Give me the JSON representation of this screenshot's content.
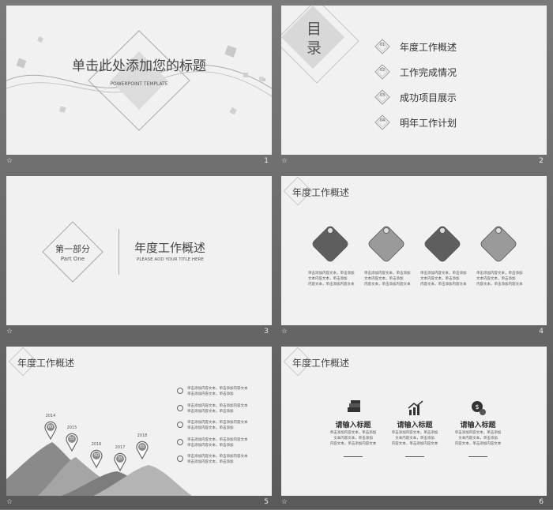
{
  "slide1": {
    "title": "单击此处添加您的标题",
    "subtitle": "POWERPOINT TEMPLATE",
    "number": "1"
  },
  "slide2": {
    "title_char1": "目",
    "title_char2": "录",
    "items": [
      {
        "num": "01",
        "label": "年度工作概述"
      },
      {
        "num": "02",
        "label": "工作完成情况"
      },
      {
        "num": "03",
        "label": "成功项目展示"
      },
      {
        "num": "04",
        "label": "明年工作计划"
      }
    ],
    "number": "2"
  },
  "slide3": {
    "part_label": "第一部分",
    "part_en": "Part One",
    "title": "年度工作概述",
    "subtitle": "PLEASE ADD YOUR TITLE HERE",
    "number": "3"
  },
  "slide4": {
    "title": "年度工作概述",
    "text_line1": "单击添加内容文本，单击添加",
    "text_line2": "文本内容文本，单击添加",
    "text_line3": "内容文本，单击添加内容文本",
    "number": "4"
  },
  "slide5": {
    "title": "年度工作概述",
    "years": [
      {
        "year": "2014",
        "value": "80"
      },
      {
        "year": "2015",
        "value": "55"
      },
      {
        "year": "2016",
        "value": "50"
      },
      {
        "year": "2017",
        "value": "35"
      },
      {
        "year": "2018",
        "value": "65"
      }
    ],
    "bullet_text1": "单击添加内容文本，单击添加内容文本",
    "bullet_text2": "单击添加内容文本，单击添加",
    "number": "5"
  },
  "slide6": {
    "title": "年度工作概述",
    "columns": [
      {
        "icon": "money-stack-icon",
        "heading": "请输入标题"
      },
      {
        "icon": "growth-chart-icon",
        "heading": "请输入标题"
      },
      {
        "icon": "dollar-coins-icon",
        "heading": "请输入标题"
      }
    ],
    "text_line1": "单击添加内容文本，单击添加",
    "text_line2": "文本内容文本，单击添加",
    "text_line3": "内容文本，单击添加内容文本",
    "number": "6"
  },
  "footer_mark": "☆"
}
